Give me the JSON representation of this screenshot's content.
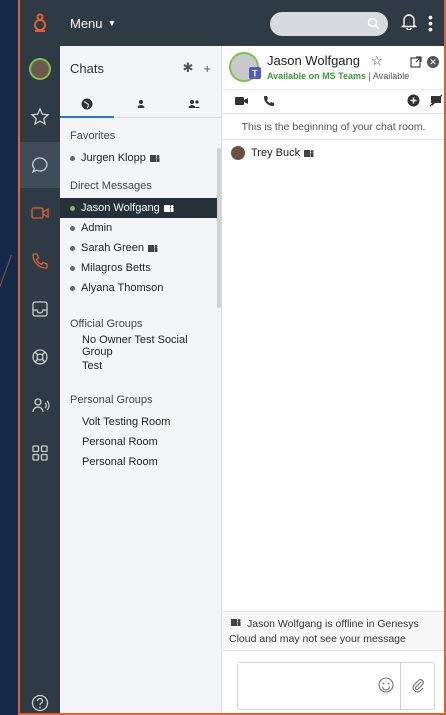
{
  "topbar": {
    "menu_label": "Menu"
  },
  "chats": {
    "title": "Chats",
    "sections": {
      "favorites": {
        "title": "Favorites",
        "items": [
          "Jurgen Klopp"
        ]
      },
      "direct": {
        "title": "Direct Messages",
        "items": [
          "Jason Wolfgang",
          "Admin",
          "Sarah Green",
          "Milagros Betts",
          "Alyana Thomson"
        ]
      },
      "official": {
        "title": "Official Groups",
        "items": [
          "No Owner Test Social Group",
          "Test"
        ]
      },
      "personal": {
        "title": "Personal Groups",
        "items": [
          "Volt Testing Room",
          "Personal Room",
          "Personal Room"
        ]
      }
    }
  },
  "chat": {
    "contact_name": "Jason Wolfgang",
    "status_teams": "Available on MS Teams",
    "status_sep": "|",
    "status_genesys": "Available",
    "beginning_text": "This is the beginning of your chat room.",
    "message_author": "Trey Buck",
    "offline_note": "Jason Wolfgang is offline in Genesys Cloud and may not see your message",
    "composer_placeholder": ""
  },
  "colors": {
    "accent": "#e0612f",
    "rail": "#2e3a44",
    "online": "#7cc24e",
    "tab_active": "#1f7ad6"
  }
}
